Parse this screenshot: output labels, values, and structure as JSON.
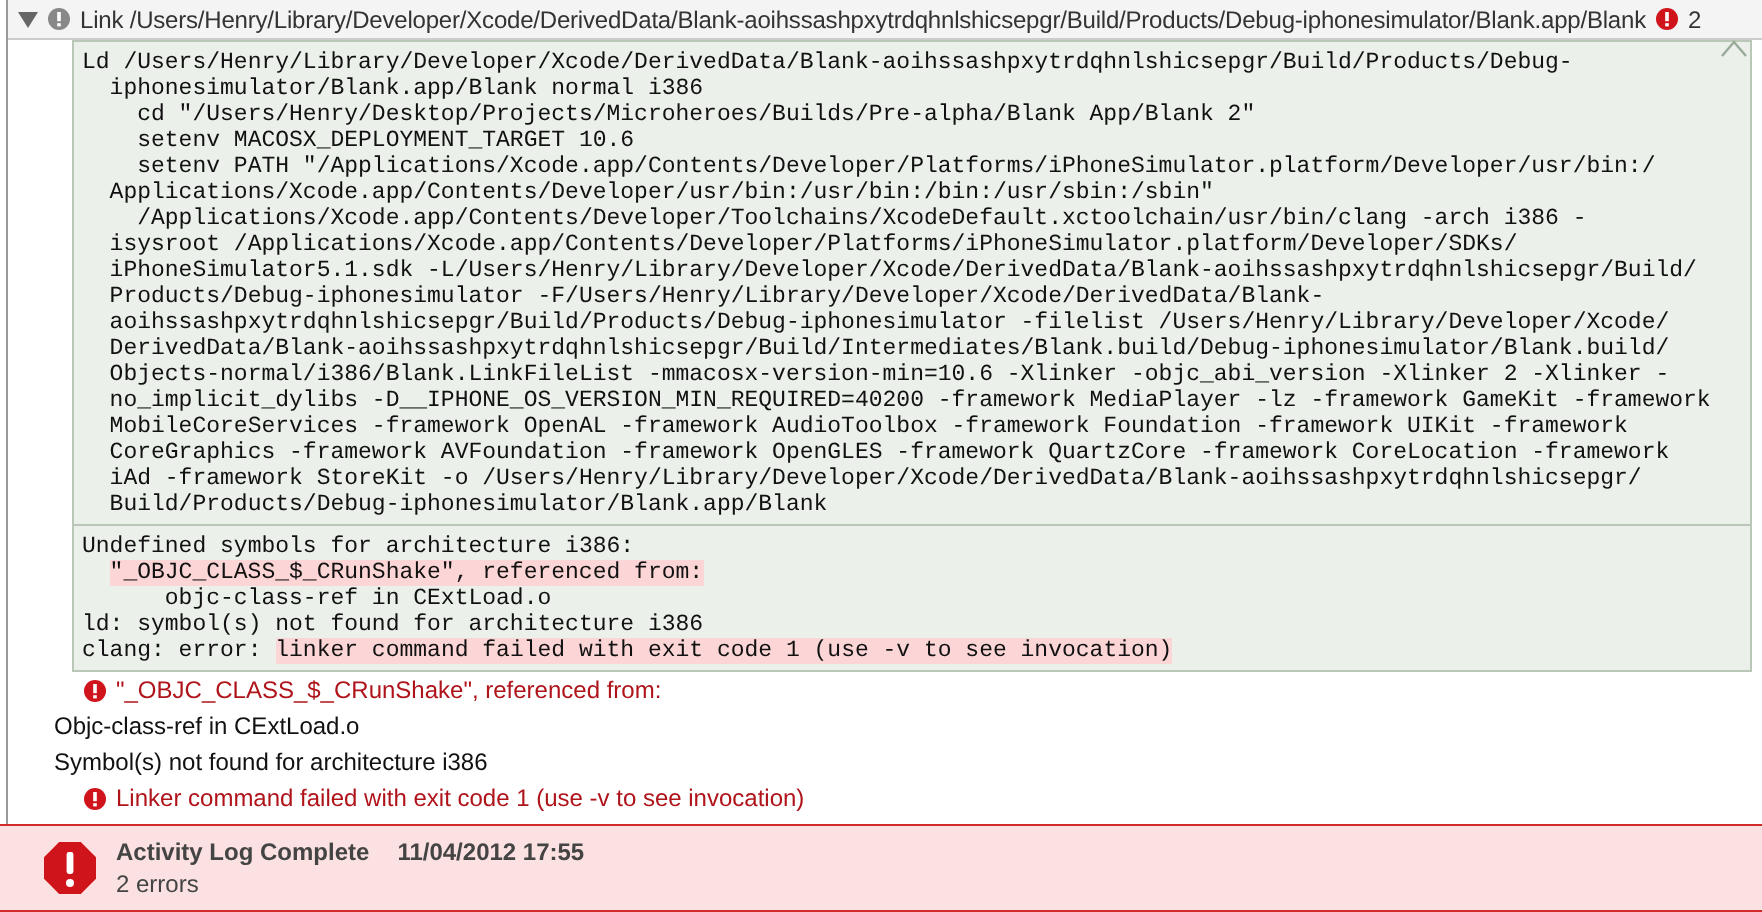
{
  "header": {
    "expanded": true,
    "title": "Link /Users/Henry/Library/Developer/Xcode/DerivedData/Blank-aoihssashpxytrdqhnlshicsepgr/Build/Products/Debug-iphonesimulator/Blank.app/Blank",
    "error_count": "2"
  },
  "log_sections": [
    {
      "lines": [
        [
          {
            "kind": "plain",
            "text": "Ld /Users/Henry/Library/Developer/Xcode/DerivedData/Blank-aoihssashpxytrdqhnlshicsepgr/Build/Products/Debug-"
          }
        ],
        [
          {
            "kind": "plain",
            "text": "  iphonesimulator/Blank.app/Blank normal i386"
          }
        ],
        [
          {
            "kind": "plain",
            "text": "    cd \"/Users/Henry/Desktop/Projects/Microheroes/Builds/Pre-alpha/Blank App/Blank 2\""
          }
        ],
        [
          {
            "kind": "plain",
            "text": "    setenv MACOSX_DEPLOYMENT_TARGET 10.6"
          }
        ],
        [
          {
            "kind": "plain",
            "text": "    setenv PATH \"/Applications/Xcode.app/Contents/Developer/Platforms/iPhoneSimulator.platform/Developer/usr/bin:/"
          }
        ],
        [
          {
            "kind": "plain",
            "text": "  Applications/Xcode.app/Contents/Developer/usr/bin:/usr/bin:/bin:/usr/sbin:/sbin\""
          }
        ],
        [
          {
            "kind": "plain",
            "text": "    /Applications/Xcode.app/Contents/Developer/Toolchains/XcodeDefault.xctoolchain/usr/bin/clang -arch i386 -"
          }
        ],
        [
          {
            "kind": "plain",
            "text": "  isysroot /Applications/Xcode.app/Contents/Developer/Platforms/iPhoneSimulator.platform/Developer/SDKs/"
          }
        ],
        [
          {
            "kind": "plain",
            "text": "  iPhoneSimulator5.1.sdk -L/Users/Henry/Library/Developer/Xcode/DerivedData/Blank-aoihssashpxytrdqhnlshicsepgr/Build/"
          }
        ],
        [
          {
            "kind": "plain",
            "text": "  Products/Debug-iphonesimulator -F/Users/Henry/Library/Developer/Xcode/DerivedData/Blank-"
          }
        ],
        [
          {
            "kind": "plain",
            "text": "  aoihssashpxytrdqhnlshicsepgr/Build/Products/Debug-iphonesimulator -filelist /Users/Henry/Library/Developer/Xcode/"
          }
        ],
        [
          {
            "kind": "plain",
            "text": "  DerivedData/Blank-aoihssashpxytrdqhnlshicsepgr/Build/Intermediates/Blank.build/Debug-iphonesimulator/Blank.build/"
          }
        ],
        [
          {
            "kind": "plain",
            "text": "  Objects-normal/i386/Blank.LinkFileList -mmacosx-version-min=10.6 -Xlinker -objc_abi_version -Xlinker 2 -Xlinker -"
          }
        ],
        [
          {
            "kind": "plain",
            "text": "  no_implicit_dylibs -D__IPHONE_OS_VERSION_MIN_REQUIRED=40200 -framework MediaPlayer -lz -framework GameKit -framework"
          }
        ],
        [
          {
            "kind": "plain",
            "text": "  MobileCoreServices -framework OpenAL -framework AudioToolbox -framework Foundation -framework UIKit -framework"
          }
        ],
        [
          {
            "kind": "plain",
            "text": "  CoreGraphics -framework AVFoundation -framework OpenGLES -framework QuartzCore -framework CoreLocation -framework"
          }
        ],
        [
          {
            "kind": "plain",
            "text": "  iAd -framework StoreKit -o /Users/Henry/Library/Developer/Xcode/DerivedData/Blank-aoihssashpxytrdqhnlshicsepgr/"
          }
        ],
        [
          {
            "kind": "plain",
            "text": "  Build/Products/Debug-iphonesimulator/Blank.app/Blank"
          }
        ]
      ]
    },
    {
      "lines": [
        [
          {
            "kind": "plain",
            "text": "Undefined symbols for architecture i386:"
          }
        ],
        [
          {
            "kind": "nested_error",
            "text": "\"_OBJC_CLASS_$_CRunShake\", referenced from:"
          }
        ],
        [
          {
            "kind": "plain",
            "text": "      objc-class-ref in CExtLoad.o"
          }
        ],
        [
          {
            "kind": "plain",
            "text": "ld: symbol(s) not found for architecture i386"
          }
        ],
        [
          {
            "kind": "plain",
            "text": "clang: error: "
          },
          {
            "kind": "error",
            "text": "linker command failed with exit code 1 (use -v to see invocation)"
          }
        ]
      ]
    }
  ],
  "messages": [
    {
      "kind": "error",
      "text": "\"_OBJC_CLASS_$_CRunShake\", referenced from:"
    },
    {
      "kind": "note",
      "text": "Objc-class-ref in CExtLoad.o"
    },
    {
      "kind": "note",
      "text": "Symbol(s) not found for architecture i386"
    },
    {
      "kind": "error",
      "text": "Linker command failed with exit code 1 (use -v to see invocation)"
    }
  ],
  "footer": {
    "title": "Activity Log Complete",
    "timestamp": "11/04/2012 17:55",
    "summary": "2 errors"
  }
}
